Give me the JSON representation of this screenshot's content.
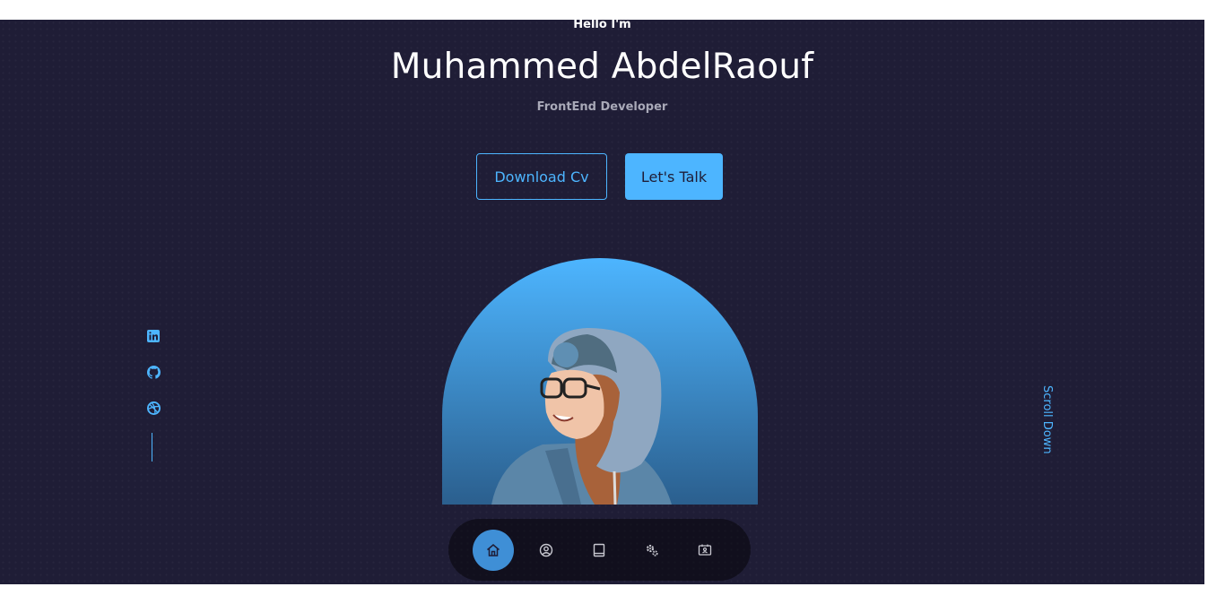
{
  "hero": {
    "greeting": "Hello I'm",
    "name": "Muhammed AbdelRaouf",
    "role": "FrontEnd Developer"
  },
  "cta": {
    "download_label": "Download Cv",
    "talk_label": "Let's Talk"
  },
  "socials": [
    {
      "icon": "linkedin-icon"
    },
    {
      "icon": "github-icon"
    },
    {
      "icon": "dribbble-icon"
    }
  ],
  "scroll_down_label": "Scroll Down",
  "nav": {
    "items": [
      {
        "icon": "home-icon",
        "active": true
      },
      {
        "icon": "user-icon",
        "active": false
      },
      {
        "icon": "book-icon",
        "active": false
      },
      {
        "icon": "services-icon",
        "active": false
      },
      {
        "icon": "contact-card-icon",
        "active": false
      }
    ]
  },
  "colors": {
    "background": "#1f1d36",
    "accent": "#4db5ff",
    "text": "#ffffff",
    "muted_text": "#a9a9b8"
  }
}
